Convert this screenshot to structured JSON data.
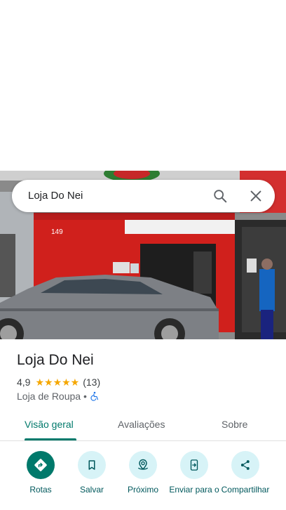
{
  "search": {
    "query": "Loja Do Nei"
  },
  "hero": {
    "storefront_number": "149"
  },
  "place": {
    "name": "Loja Do Nei",
    "rating": "4,9",
    "stars": "★★★★★",
    "review_count": "(13)",
    "category": "Loja de Roupa •"
  },
  "tabs": [
    {
      "label": "Visão geral",
      "active": true
    },
    {
      "label": "Avaliações",
      "active": false
    },
    {
      "label": "Sobre",
      "active": false
    }
  ],
  "actions": [
    {
      "label": "Rotas",
      "icon": "directions-icon"
    },
    {
      "label": "Salvar",
      "icon": "bookmark-icon"
    },
    {
      "label": "Próximo",
      "icon": "nearby-icon"
    },
    {
      "label": "Enviar para o",
      "icon": "send-to-phone-icon"
    },
    {
      "label": "Compartilhar",
      "icon": "share-icon"
    }
  ],
  "colors": {
    "accent": "#00796b",
    "action_bg": "#d7f3f7",
    "star": "#f5a700"
  }
}
